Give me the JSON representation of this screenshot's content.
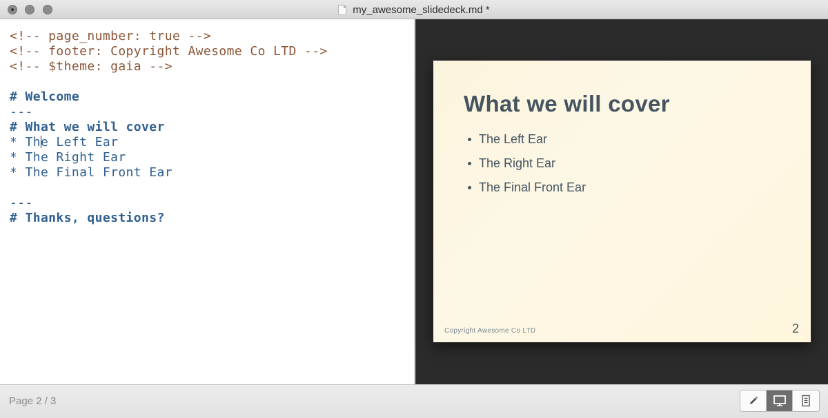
{
  "window": {
    "title": "my_awesome_slidedeck.md *"
  },
  "editor": {
    "lines": [
      "<!-- page_number: true -->",
      "<!-- footer: Copyright Awesome Co LTD -->",
      "<!-- $theme: gaia -->",
      "",
      "# Welcome",
      "---",
      "# What we will cover",
      "* The Left Ear",
      "* The Right Ear",
      "* The Final Front Ear",
      "",
      "---",
      "# Thanks, questions?"
    ],
    "cursor_line_prefix": "* Th",
    "cursor_line_suffix": "e Left Ear"
  },
  "slide": {
    "title": "What we will cover",
    "bullets": [
      "The Left Ear",
      "The Right Ear",
      "The Final Front Ear"
    ],
    "footer": "Copyright Awesome Co LTD",
    "page_number": "2"
  },
  "status": {
    "page_indicator": "Page 2 / 3"
  },
  "view_modes": {
    "icons": [
      "pencil-icon",
      "monitor-icon",
      "document-icon"
    ],
    "active": "monitor-icon"
  }
}
